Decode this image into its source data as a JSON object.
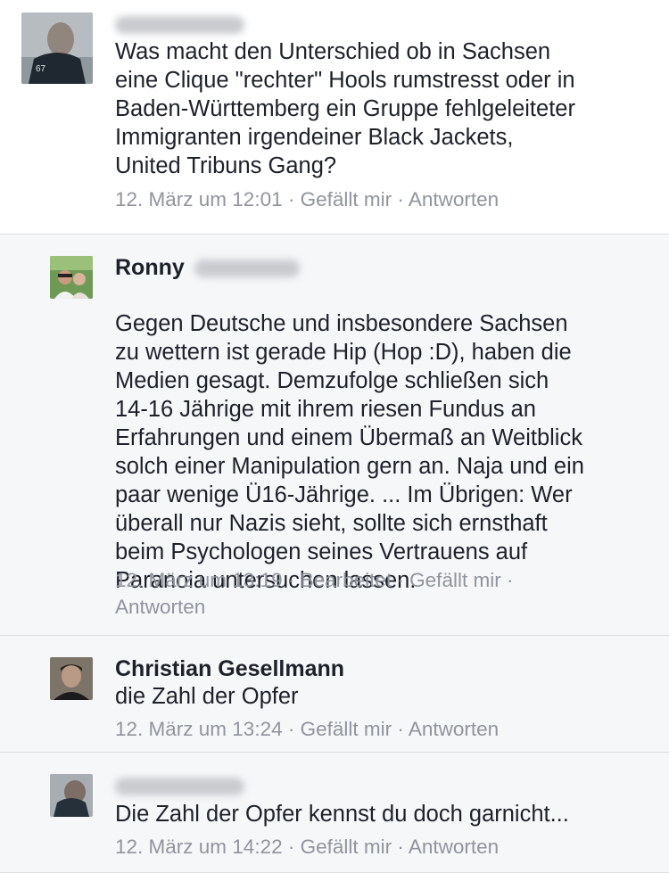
{
  "comments": [
    {
      "author_first": "",
      "author_blurred": true,
      "text": "Was macht den Unterschied ob in Sachsen\neine Clique \"rechter\" Hools rumstresst oder in\nBaden-Württemberg ein Gruppe fehlgeleiteter\nImmigranten irgendeiner Black Jackets,\nUnited Tribuns Gang?",
      "time": "12. März um 12:01",
      "edited": "",
      "like": "Gefällt mir",
      "reply": "Antworten"
    },
    {
      "author_first": "Ronny",
      "author_blurred": true,
      "text": "Gegen Deutsche und insbesondere Sachsen\nzu wettern ist gerade Hip (Hop :D), haben die\nMedien gesagt. Demzufolge schließen sich\n14-16 Jährige mit ihrem riesen Fundus an\nErfahrungen und einem Übermaß an Weitblick\nsolch einer Manipulation gern an. Naja und ein\npaar wenige Ü16-Jährige. ... Im Übrigen: Wer\nüberall nur Nazis sieht, sollte sich ernsthaft\nbeim Psychologen seines Vertrauens auf\nParanoia untersuchen lassen.",
      "time": "12. März um 13:19",
      "edited": "Bearbeitet",
      "like": "Gefällt mir",
      "reply": "Antworten"
    },
    {
      "author_first": "Christian Gesellmann",
      "author_blurred": false,
      "text": "die Zahl der Opfer",
      "time": "12. März um 13:24",
      "edited": "",
      "like": "Gefällt mir",
      "reply": "Antworten"
    },
    {
      "author_first": "",
      "author_blurred": true,
      "text": "Die Zahl der Opfer kennst du doch garnicht...",
      "time": "12. März um 14:22",
      "edited": "",
      "like": "Gefällt mir",
      "reply": "Antworten"
    }
  ],
  "separator": " · "
}
